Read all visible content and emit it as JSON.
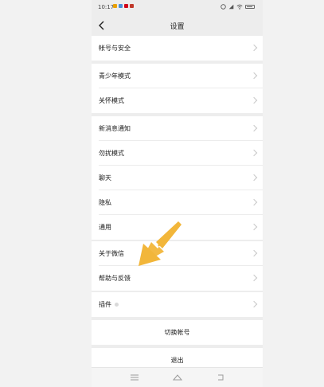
{
  "status": {
    "time": "10:17",
    "colors": [
      "#e8a000",
      "#4a90d9",
      "#d0021b",
      "#c0392b"
    ]
  },
  "header": {
    "title": "设置",
    "back_icon": "chevron-left-icon"
  },
  "groups": {
    "account": {
      "label": "帐号与安全"
    },
    "youth": {
      "label": "青少年模式"
    },
    "care": {
      "label": "关怀模式"
    },
    "notify": {
      "label": "新消息通知"
    },
    "dnd": {
      "label": "勿扰模式"
    },
    "chat": {
      "label": "聊天"
    },
    "privacy": {
      "label": "隐私"
    },
    "general": {
      "label": "通用"
    },
    "about": {
      "label": "关于微信"
    },
    "help": {
      "label": "帮助与反馈"
    },
    "plugins": {
      "label": "插件"
    }
  },
  "actions": {
    "switch_account": "切换帐号",
    "logout": "退出"
  },
  "annotation": {
    "arrow_color": "#f2b63a",
    "points_to": "帮助与反馈"
  }
}
